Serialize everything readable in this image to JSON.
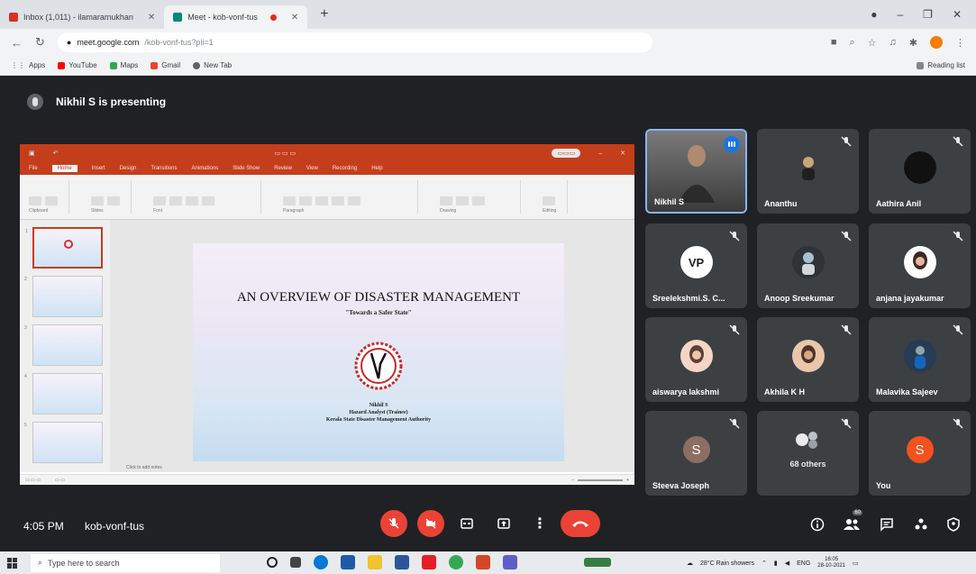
{
  "browser": {
    "tabs": [
      {
        "title": "Inbox (1,011) - ilamaramukhan",
        "icon": "gmail-icon"
      },
      {
        "title": "Meet - kob-vonf-tus",
        "icon": "meet-icon",
        "active": true
      }
    ],
    "url_host": "meet.google.com",
    "url_path": "/kob-vonf-tus?pli=1",
    "bookmarks": [
      "Apps",
      "YouTube",
      "Maps",
      "Gmail",
      "New Tab"
    ],
    "reading_list": "Reading list"
  },
  "meet": {
    "presenter_banner": "Nikhil S is presenting",
    "meeting_time": "4:05 PM",
    "meeting_code": "kob-vonf-tus",
    "participant_badge": "60",
    "participants": [
      {
        "name": "Nikhil S",
        "type": "video",
        "speaking": true
      },
      {
        "name": "Ananthu",
        "type": "photo",
        "color": "#3c4043"
      },
      {
        "name": "Aathira Anil",
        "type": "photo",
        "color": "#202124"
      },
      {
        "name": "Sreelekshmi.S. C...",
        "type": "photo",
        "color": "#ffffff"
      },
      {
        "name": "Anoop Sreekumar",
        "type": "photo",
        "color": "#3c4043"
      },
      {
        "name": "anjana jayakumar",
        "type": "photo",
        "color": "#ffffff"
      },
      {
        "name": "aiswarya lakshmi",
        "type": "photo",
        "color": "#f5d6c6"
      },
      {
        "name": "Akhila K H",
        "type": "photo",
        "color": "#e9c7a8"
      },
      {
        "name": "Malavika Sajeev",
        "type": "photo",
        "color": "#263b55"
      },
      {
        "name": "Steeva Joseph",
        "type": "initial",
        "initial": "S",
        "color": "#8d6e63"
      },
      {
        "name": "68 others",
        "type": "others"
      },
      {
        "name": "You",
        "type": "initial",
        "initial": "S",
        "color": "#f4511e"
      }
    ]
  },
  "slide": {
    "title": "AN OVERVIEW OF DISASTER MANAGEMENT",
    "subtitle": "\"Towards a Safer State\"",
    "author": "Nikhil S",
    "role": "Hazard Analyst (Trainee)",
    "org": "Kerala State Disaster Management Authority",
    "notes_hint": "Click to add notes"
  },
  "ppt": {
    "ribbon_tabs": [
      "File",
      "Home",
      "Insert",
      "Design",
      "Transitions",
      "Animations",
      "Slide Show",
      "Review",
      "View",
      "Recording",
      "Help"
    ],
    "ribbon_groups": [
      "Clipboard",
      "Slides",
      "Font",
      "Paragraph",
      "Drawing",
      "Editing"
    ],
    "thumb_numbers": [
      "1",
      "2",
      "3",
      "4",
      "5"
    ]
  },
  "taskbar": {
    "search_placeholder": "Type here to search",
    "weather": "28°C Rain showers",
    "language": "ENG",
    "time": "16:05",
    "date": "28-10-2021"
  }
}
